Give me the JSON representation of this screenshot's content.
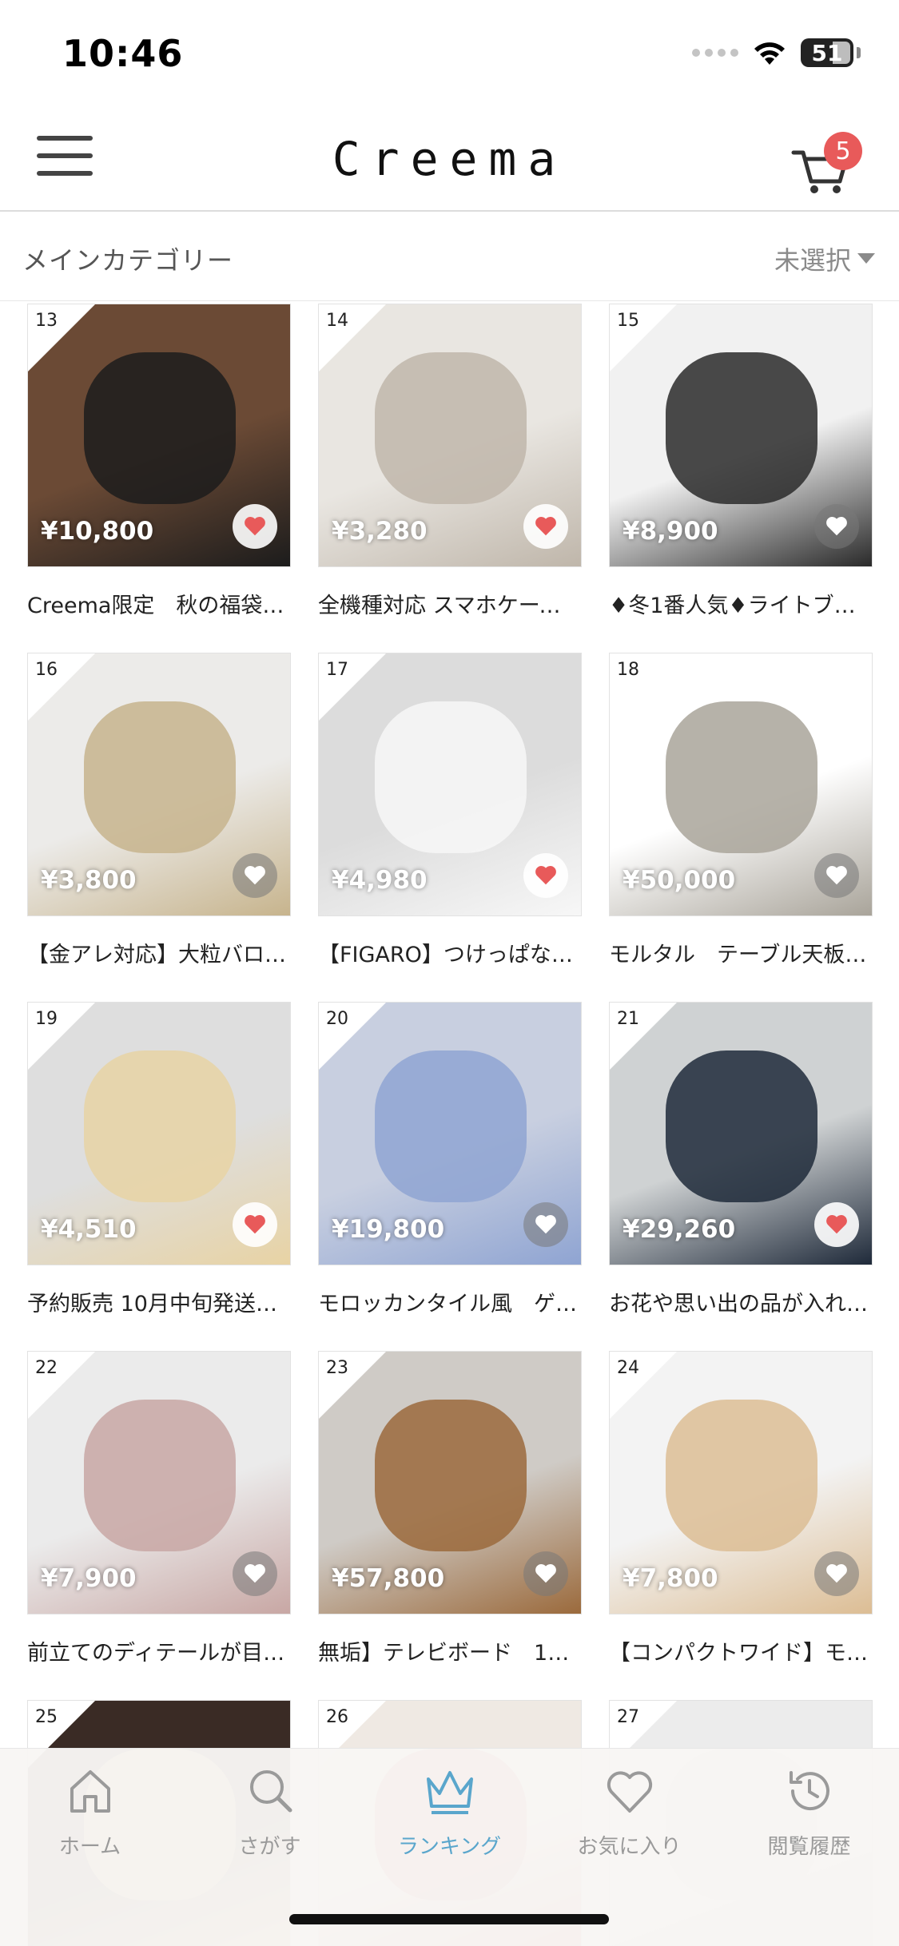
{
  "status_bar": {
    "time": "10:46",
    "battery": "51"
  },
  "header": {
    "logo": "Creema",
    "cart_count": "5"
  },
  "category": {
    "label": "メインカテゴリー",
    "value": "未選択"
  },
  "products": [
    {
      "rank": "13",
      "price": "¥10,800",
      "title": "Creema限定　秋の福袋…",
      "favorited": true,
      "bg": "#6b4a35",
      "fg": "#1c1c1c"
    },
    {
      "rank": "14",
      "price": "¥3,280",
      "title": "全機種対応 スマホケース…",
      "favorited": true,
      "bg": "#e9e6e1",
      "fg": "#bfb6aa"
    },
    {
      "rank": "15",
      "price": "¥8,900",
      "title": "♦冬1番人気♦ライトブ…",
      "favorited": false,
      "bg": "#f1f1f1",
      "fg": "#2a2a2a"
    },
    {
      "rank": "16",
      "price": "¥3,800",
      "title": "【金アレ対応】大粒バロッ…",
      "favorited": false,
      "bg": "#ecebe9",
      "fg": "#c7b48d"
    },
    {
      "rank": "17",
      "price": "¥4,980",
      "title": "【FIGARO】つけっぱなし…",
      "favorited": true,
      "bg": "#dcdcdc",
      "fg": "#f7f7f7"
    },
    {
      "rank": "18",
      "price": "¥50,000",
      "title": "モルタル　テーブル天板…",
      "favorited": false,
      "bg": "#ffffff",
      "fg": "#a9a49a"
    },
    {
      "rank": "19",
      "price": "¥4,510",
      "title": "予約販売 10月中旬発送…",
      "favorited": true,
      "bg": "#dedede",
      "fg": "#e8d3a4"
    },
    {
      "rank": "20",
      "price": "¥19,800",
      "title": "モロッカンタイル風　ゲ…",
      "favorited": false,
      "bg": "#c8cfe0",
      "fg": "#8fa4d2"
    },
    {
      "rank": "21",
      "price": "¥29,260",
      "title": "お花や思い出の品が入れ…",
      "favorited": true,
      "bg": "#cfd2d3",
      "fg": "#1f2a3a"
    },
    {
      "rank": "22",
      "price": "¥7,900",
      "title": "前立てのディテールが目…",
      "favorited": false,
      "bg": "#ebebeb",
      "fg": "#c8a7a4"
    },
    {
      "rank": "23",
      "price": "¥57,800",
      "title": "無垢】テレビボード　18…",
      "favorited": false,
      "bg": "#cfcbc6",
      "fg": "#9b6a3c"
    },
    {
      "rank": "24",
      "price": "¥7,800",
      "title": "【コンパクトワイド】モダ…",
      "favorited": false,
      "bg": "#f3f3f3",
      "fg": "#dcbd94"
    },
    {
      "rank": "25",
      "price": "",
      "title": "",
      "favorited": false,
      "bg": "#3a2b25",
      "fg": "#d6b36a"
    },
    {
      "rank": "26",
      "price": "",
      "title": "",
      "favorited": false,
      "bg": "#efe9e3",
      "fg": "#c24a4a"
    },
    {
      "rank": "27",
      "price": "",
      "title": "",
      "favorited": false,
      "bg": "#ececec",
      "fg": "#d0d0d0"
    }
  ],
  "tabs": [
    {
      "label": "ホーム",
      "icon": "home-icon",
      "active": false
    },
    {
      "label": "さがす",
      "icon": "search-icon",
      "active": false
    },
    {
      "label": "ランキング",
      "icon": "crown-icon",
      "active": true
    },
    {
      "label": "お気に入り",
      "icon": "heart-icon",
      "active": false
    },
    {
      "label": "閲覧履歴",
      "icon": "history-icon",
      "active": false
    }
  ],
  "colors": {
    "accent": "#5aa6cc",
    "badge": "#e85a5a",
    "heart": "#e85a5a"
  }
}
